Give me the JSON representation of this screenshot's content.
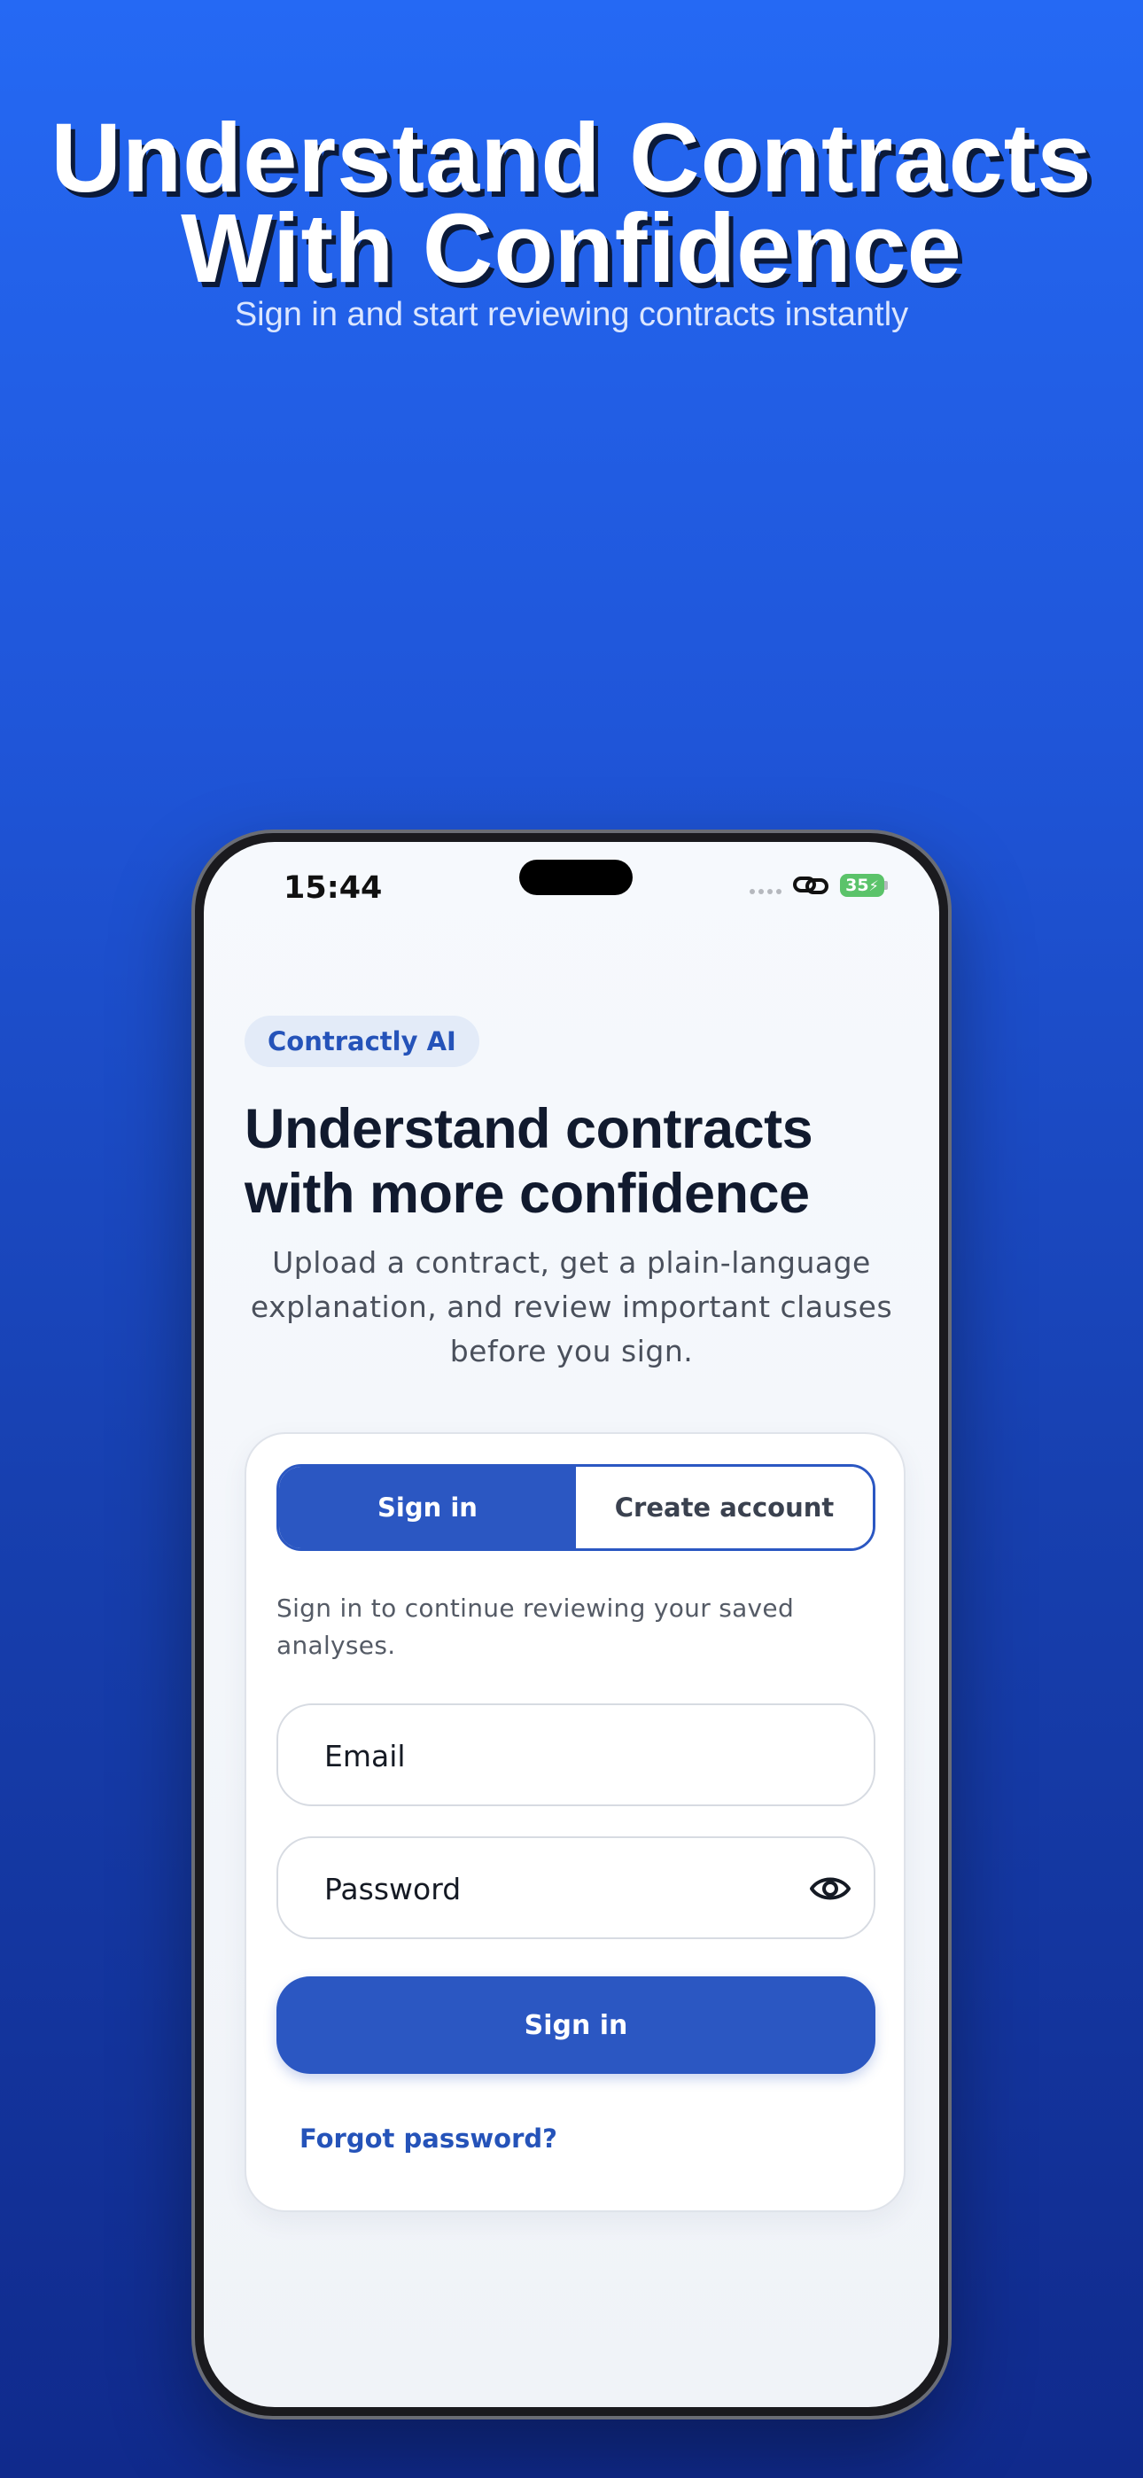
{
  "promo": {
    "title_line1": "Understand Contracts",
    "title_line2": "With Confidence",
    "subtitle": "Sign in and start reviewing contracts instantly"
  },
  "status_bar": {
    "time": "15:44",
    "battery": "35",
    "icons": [
      "signal-dots-icon",
      "link-icon",
      "battery-charging-icon"
    ]
  },
  "app": {
    "badge": "Contractly AI",
    "headline_line1": "Understand contracts",
    "headline_line2": "with more confidence",
    "intro": "Upload a contract, get a plain-language explanation, and review important clauses before you sign."
  },
  "auth": {
    "tabs": [
      {
        "label": "Sign in",
        "active": true
      },
      {
        "label": "Create account",
        "active": false
      }
    ],
    "helper": "Sign in to continue reviewing your saved analyses.",
    "email": {
      "placeholder": "Email",
      "value": ""
    },
    "password": {
      "placeholder": "Password",
      "value": ""
    },
    "submit_label": "Sign in",
    "forgot_label": "Forgot password?"
  },
  "colors": {
    "accent": "#2b57c2",
    "background_top": "#2569f4",
    "background_bottom": "#102a8c",
    "battery": "#5bc36a"
  }
}
